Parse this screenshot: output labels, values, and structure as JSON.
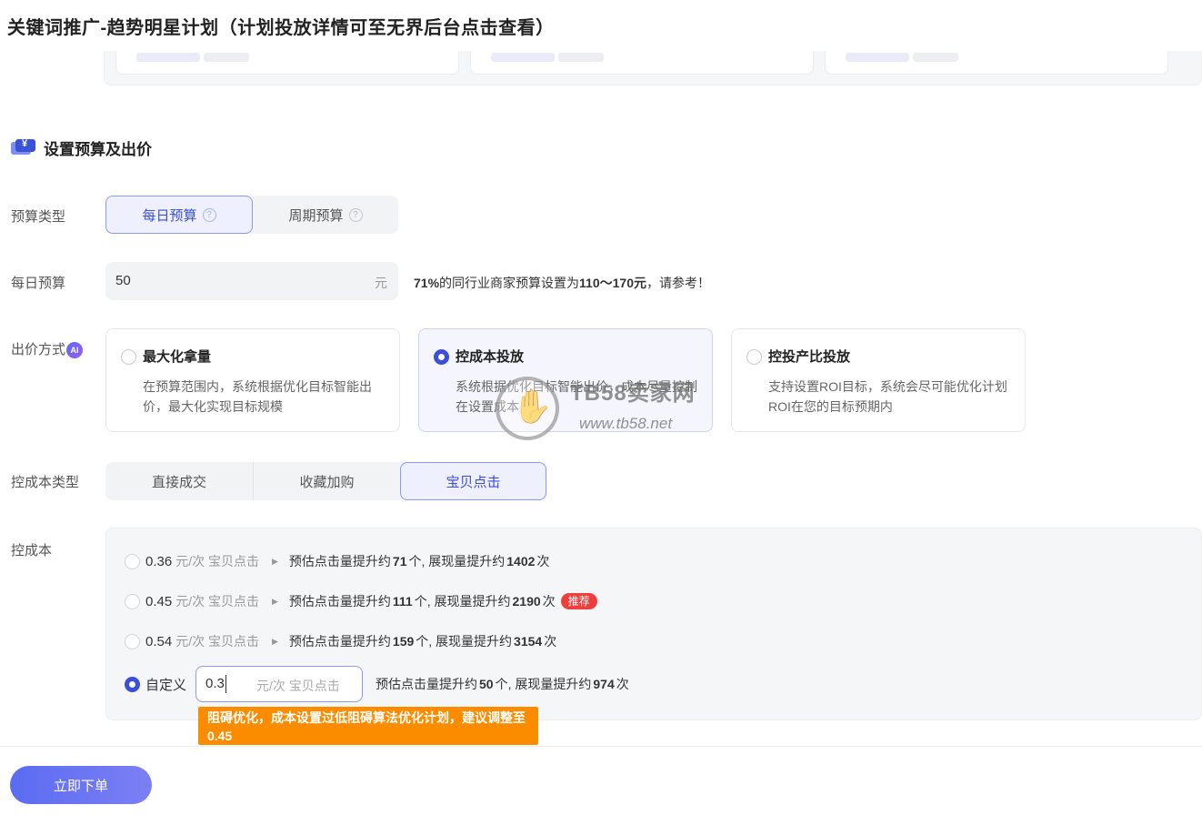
{
  "header": {
    "title": "关键词推广-趋势明星计划（计划投放详情可至无界后台点击查看）"
  },
  "section": {
    "title": "设置预算及出价"
  },
  "budget_type": {
    "label": "预算类型",
    "options": [
      {
        "label": "每日预算",
        "active": true
      },
      {
        "label": "周期预算",
        "active": false
      }
    ],
    "help_icon": "question-circle-icon"
  },
  "daily_budget": {
    "label": "每日预算",
    "value": "50",
    "unit": "元",
    "hint_prefix": "71%",
    "hint_mid": "的同行业商家预算设置为",
    "hint_range": "110～170元",
    "hint_suffix": "，请参考！"
  },
  "bid_method": {
    "label": "出价方式",
    "ai_badge": "AI",
    "cards": [
      {
        "title": "最大化拿量",
        "desc": "在预算范围内，系统根据优化目标智能出价，最大化实现目标规模",
        "selected": false
      },
      {
        "title": "控成本投放",
        "desc": "系统根据优化目标智能出价，成本尽量控制在设置成本",
        "selected": true
      },
      {
        "title": "控投产比投放",
        "desc": "支持设置ROI目标，系统会尽可能优化计划ROI在您的目标预期内",
        "selected": false
      }
    ]
  },
  "watermark": {
    "brand": "TB58卖家网",
    "url": "www.tb58.net"
  },
  "cost_type": {
    "label": "控成本类型",
    "options": [
      {
        "label": "直接成交",
        "active": false
      },
      {
        "label": "收藏加购",
        "active": false
      },
      {
        "label": "宝贝点击",
        "active": true
      }
    ]
  },
  "cost_control": {
    "label": "控成本",
    "unit": "元/次 宝贝点击",
    "est_click_prefix": "预估点击量提升约",
    "est_click_unit": "个, 展现量提升约",
    "est_impr_unit": "次",
    "options": [
      {
        "price": "0.36",
        "clicks": "71",
        "impressions": "1402",
        "recommended": false
      },
      {
        "price": "0.45",
        "clicks": "111",
        "impressions": "2190",
        "recommended": true
      },
      {
        "price": "0.54",
        "clicks": "159",
        "impressions": "3154",
        "recommended": false
      }
    ],
    "recommend_badge": "推荐",
    "custom": {
      "label": "自定义",
      "value": "0.3",
      "clicks": "50",
      "impressions": "974",
      "selected": true
    },
    "warning": "阻碍优化，成本设置过低阻碍算法优化计划，建议调整至0.45"
  },
  "footer": {
    "submit_label": "立即下单"
  },
  "colors": {
    "accent": "#3b4fd8",
    "warning": "#fb8c00",
    "recommend": "#f03e3e"
  }
}
